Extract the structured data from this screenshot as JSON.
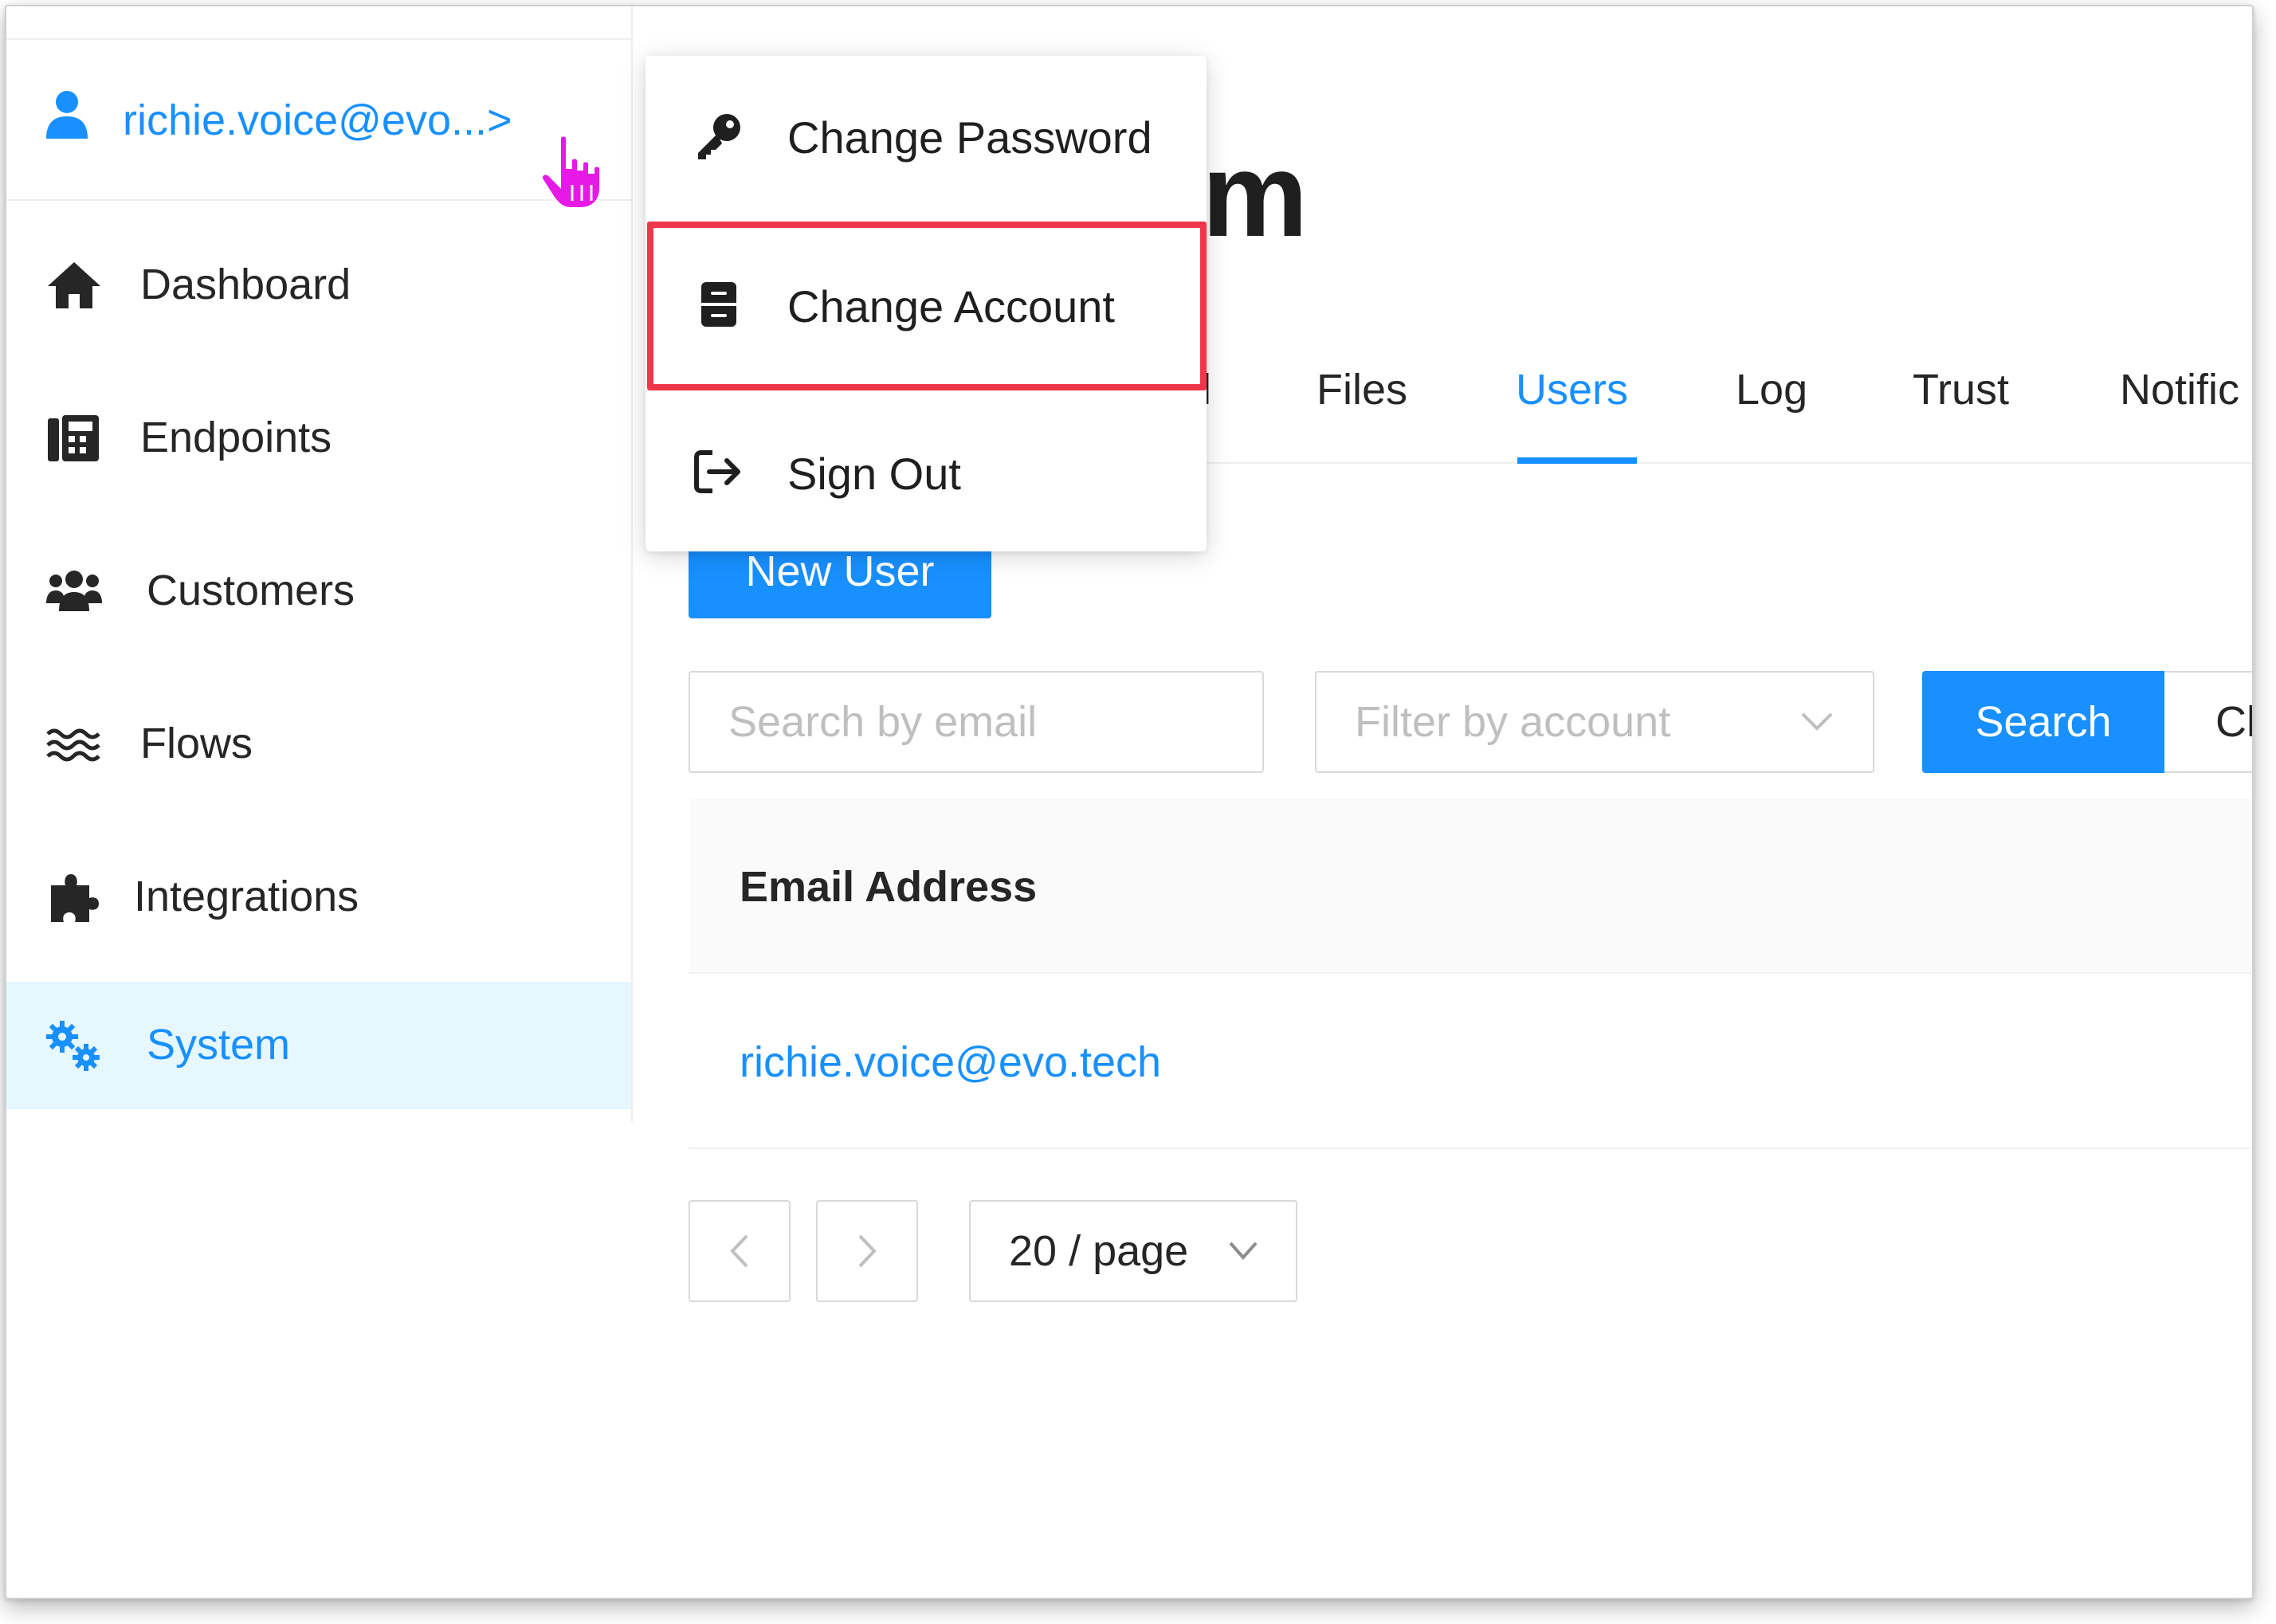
{
  "account": {
    "email": "richie.voice@evo...>"
  },
  "sidebar": {
    "items": [
      {
        "label": "Dashboard",
        "icon": "home-icon"
      },
      {
        "label": "Endpoints",
        "icon": "fax-icon"
      },
      {
        "label": "Customers",
        "icon": "users-icon"
      },
      {
        "label": "Flows",
        "icon": "water-icon"
      },
      {
        "label": "Integrations",
        "icon": "puzzle-icon"
      },
      {
        "label": "System",
        "icon": "cogs-icon",
        "active": true
      }
    ]
  },
  "page": {
    "title_fragment": "m"
  },
  "tabs": [
    {
      "label": "l"
    },
    {
      "label": "Files"
    },
    {
      "label": "Users",
      "active": true
    },
    {
      "label": "Log"
    },
    {
      "label": "Trust"
    },
    {
      "label": "Notific"
    }
  ],
  "toolbar": {
    "new_user": "New User",
    "search_placeholder": "Search by email",
    "filter_placeholder": "Filter by account",
    "search_button": "Search",
    "clear_button": "Cl"
  },
  "table": {
    "columns": [
      "Email Address"
    ],
    "rows": [
      [
        "richie.voice@evo.tech"
      ]
    ]
  },
  "pagination": {
    "page_size": "20 / page"
  },
  "menu": {
    "items": [
      {
        "label": "Change Password",
        "icon": "key-icon"
      },
      {
        "label": "Change Account",
        "icon": "archive-icon",
        "highlighted": true
      },
      {
        "label": "Sign Out",
        "icon": "sign-out-icon"
      }
    ]
  },
  "colors": {
    "accent": "#1890ff",
    "highlight": "#f0364a",
    "cursor": "#e619e6"
  }
}
